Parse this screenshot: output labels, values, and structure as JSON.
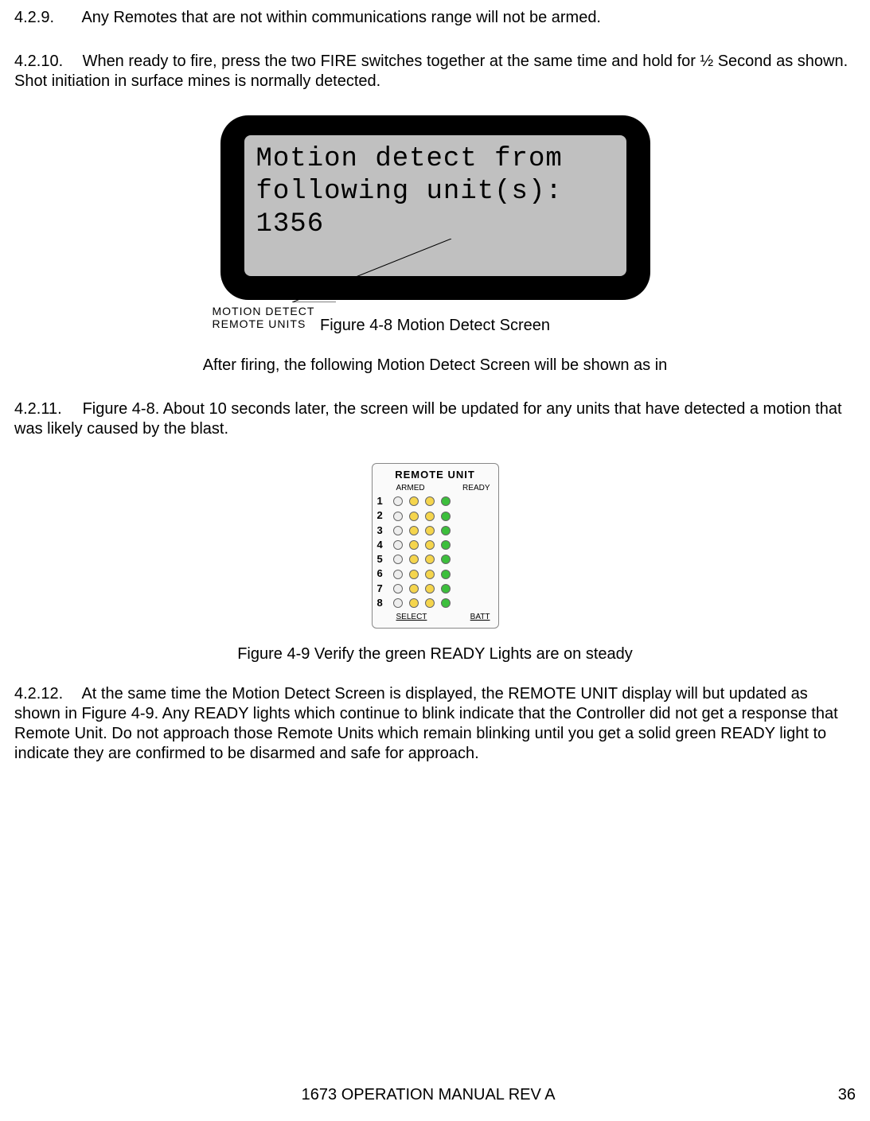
{
  "sections": {
    "s429": {
      "num": "4.2.9.",
      "text": "Any Remotes that are not within communications range will not be armed."
    },
    "s4210": {
      "num": "4.2.10.",
      "text": "When ready to fire, press the two FIRE switches together at the same time and hold for ½ Second as shown. Shot initiation in surface mines is normally detected."
    },
    "s4211": {
      "num": "4.2.11.",
      "text": "Figure 4-8. About 10 seconds later, the screen will be updated for any units that have detected a motion that was likely caused by the blast."
    },
    "s4212": {
      "num": "4.2.12.",
      "text": "At the same time the Motion Detect Screen is displayed, the REMOTE UNIT display will but updated as shown in Figure 4-9. Any READY lights which continue to blink indicate that the Controller did not get a response that Remote Unit. Do not approach those Remote Units which remain blinking until you get a solid green READY light to indicate they are confirmed to be disarmed and safe for approach."
    }
  },
  "lcd": {
    "line1": "Motion detect from",
    "line2": "following unit(s):",
    "line3": "1356",
    "leader_caption": "MOTION DETECT\nREMOTE UNITS"
  },
  "fig48_caption": "Figure 4-8 Motion Detect Screen",
  "after_firing": "After firing, the following Motion Detect Screen will be shown as in",
  "remote_panel": {
    "title": "REMOTE UNIT",
    "col_armed": "ARMED",
    "col_ready": "READY",
    "rows": [
      "1",
      "2",
      "3",
      "4",
      "5",
      "6",
      "7",
      "8"
    ],
    "foot_left": "SELECT",
    "foot_right": "BATT"
  },
  "fig49_caption": "Figure 4-9 Verify the green READY Lights are on steady",
  "footer": {
    "center": "1673 OPERATION MANUAL REV A",
    "right": "36"
  }
}
